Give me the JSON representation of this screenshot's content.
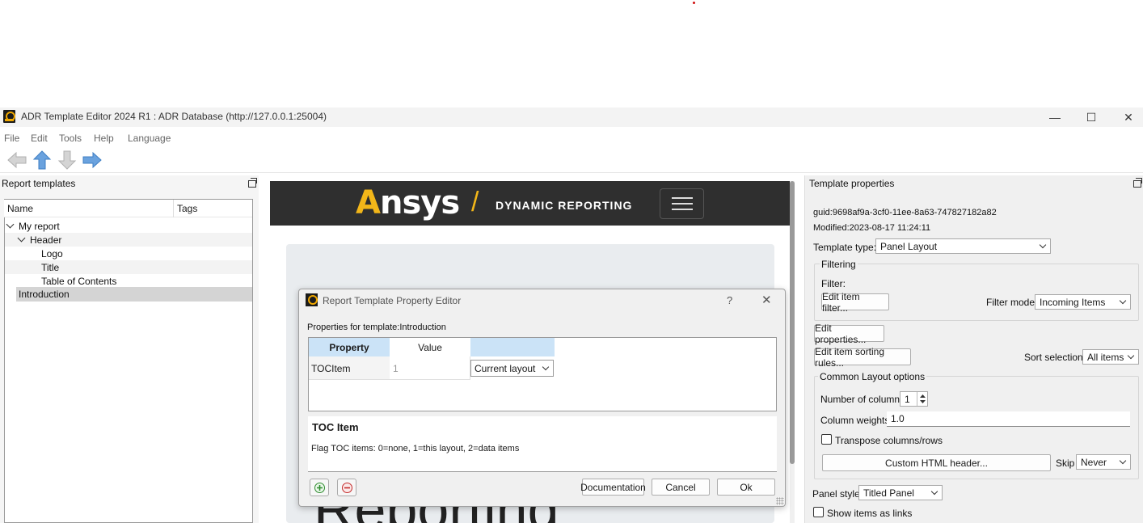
{
  "window": {
    "title": "ADR Template Editor 2024 R1 : ADR Database (http://127.0.0.1:25004)",
    "minimize": "—",
    "maximize": "☐",
    "close": "✕"
  },
  "menu": [
    "File",
    "Edit",
    "Tools",
    "Help",
    "Language"
  ],
  "toolbar": {
    "icons": [
      "arrow-left-icon",
      "arrow-up-icon",
      "arrow-down-icon",
      "arrow-right-icon"
    ]
  },
  "left_panel": {
    "title": "Report templates",
    "columns": [
      "Name",
      "Tags"
    ],
    "tree": [
      {
        "label": "My report",
        "level": 0,
        "expanded": true
      },
      {
        "label": "Header",
        "level": 1,
        "expanded": true
      },
      {
        "label": "Logo",
        "level": 2
      },
      {
        "label": "Title",
        "level": 2
      },
      {
        "label": "Table of Contents",
        "level": 2
      },
      {
        "label": "Introduction",
        "level": 1,
        "selected": true
      }
    ]
  },
  "webview": {
    "brand": "Ansys",
    "slash": "/",
    "tagline": "DYNAMIC REPORTING",
    "big_text": "Reporting"
  },
  "dialog": {
    "title": "Report Template Property Editor",
    "help": "?",
    "close": "✕",
    "subtitle": "Properties for template:Introduction",
    "table": {
      "headers": [
        "Property",
        "Value",
        ""
      ],
      "rows": [
        {
          "property": "TOCItem",
          "value": "1",
          "option": "Current layout"
        }
      ]
    },
    "description_title": "TOC Item",
    "description_text": "Flag TOC items: 0=none, 1=this layout, 2=data items",
    "buttons": {
      "documentation": "Documentation",
      "cancel": "Cancel",
      "ok": "Ok"
    }
  },
  "right_panel": {
    "title": "Template properties",
    "guid": "guid:9698af9a-3cf0-11ee-8a63-747827182a82",
    "modified": "Modified:2023-08-17 11:24:11",
    "template_type_label": "Template type:",
    "template_type_value": "Panel Layout",
    "filtering_label": "Filtering",
    "filter_label": "Filter:",
    "edit_item_filter": "Edit item filter...",
    "filter_mode_label": "Filter mode",
    "filter_mode_value": "Incoming Items",
    "edit_properties": "Edit properties...",
    "edit_sorting": "Edit item sorting rules...",
    "sort_selection_label": "Sort selection",
    "sort_selection_value": "All items",
    "common_layout_label": "Common Layout options",
    "num_columns_label": "Number of columns",
    "num_columns_value": "1",
    "column_weights_label": "Column weights",
    "column_weights_value": "1.0",
    "transpose_label": "Transpose columns/rows",
    "custom_html_header": "Custom HTML header...",
    "skip_label": "Skip",
    "skip_value": "Never",
    "panel_style_label": "Panel style",
    "panel_style_value": "Titled Panel",
    "show_links_label": "Show items as links"
  }
}
